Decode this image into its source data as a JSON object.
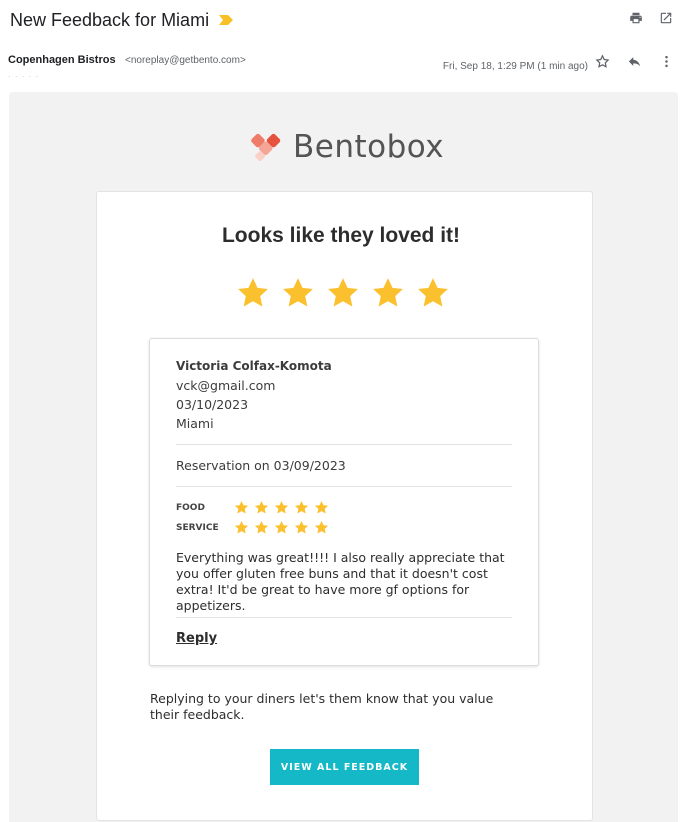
{
  "email": {
    "subject": "New Feedback for Miami",
    "sender_name": "Copenhagen Bistros",
    "sender_email": "<noreplay@getbento.com>",
    "date": "Fri, Sep 18, 1:29 PM (1 min ago)",
    "recipient_line": "· · · · ·"
  },
  "icons": {
    "importance": "importance-marker-icon",
    "print": "print-icon",
    "new_window": "open-in-new-window-icon",
    "star": "star-outline-icon",
    "reply": "reply-icon",
    "more": "more-vertical-icon"
  },
  "brand": {
    "name": "Bentobox"
  },
  "feedback": {
    "headline": "Looks like they loved it!",
    "overall_rating": 5,
    "rating_max": 5,
    "reviewer_name": "Victoria Colfax-Komota",
    "reviewer_email": "vck@gmail.com",
    "review_date": "03/10/2023",
    "location": "Miami",
    "reservation": "Reservation on 03/09/2023",
    "categories": [
      {
        "label": "FOOD",
        "rating": 5
      },
      {
        "label": "SERVICE",
        "rating": 5
      }
    ],
    "comment": "Everything was great!!!! I also really appreciate that you offer gluten free buns and that it doesn't cost extra! It'd be great to have more gf options for appetizers.",
    "reply_label": "Reply"
  },
  "footer": {
    "note": "Replying to your diners let's them know that you value their feedback.",
    "cta_label": "VIEW ALL FEEDBACK"
  },
  "colors": {
    "star": "#FBC02D",
    "cta": "#14B8C6",
    "logo_primary": "#EF6B5B",
    "logo_secondary": "#F7B6A8"
  }
}
